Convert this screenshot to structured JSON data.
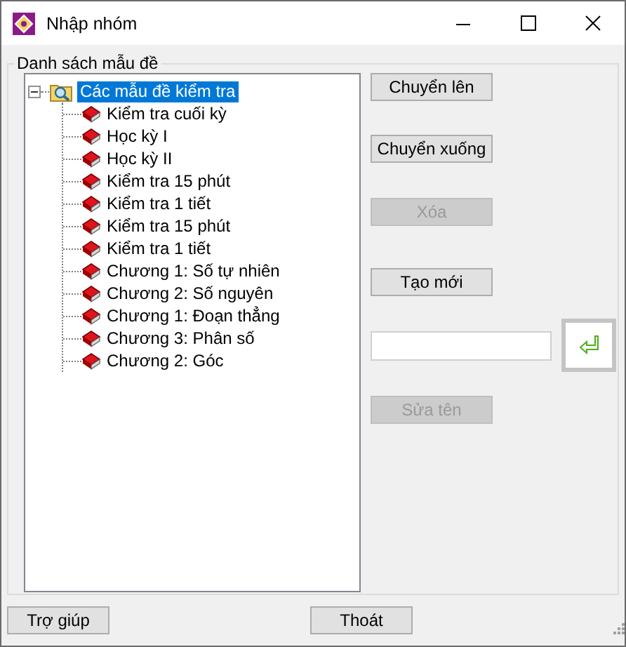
{
  "window": {
    "title": "Nhập nhóm"
  },
  "group": {
    "label": "Danh sách mẫu đề"
  },
  "tree": {
    "root": {
      "label": "Các mẫu đề kiểm tra",
      "selected": true,
      "expanded": true,
      "children": [
        {
          "label": "Kiểm tra cuối kỳ",
          "selected": false
        },
        {
          "label": "Học kỳ I",
          "selected": false
        },
        {
          "label": "Học kỳ II",
          "selected": false
        },
        {
          "label": "Kiểm tra 15 phút",
          "selected": false
        },
        {
          "label": "Kiểm tra 1 tiết",
          "selected": false
        },
        {
          "label": "Kiểm tra 15 phút",
          "selected": false
        },
        {
          "label": "Kiểm tra 1 tiết",
          "selected": false
        },
        {
          "label": "Chương 1: Số tự nhiên",
          "selected": false
        },
        {
          "label": "Chương 2: Số nguyên",
          "selected": false
        },
        {
          "label": "Chương 1: Đoạn thẳng",
          "selected": false
        },
        {
          "label": "Chương 3: Phân số",
          "selected": false
        },
        {
          "label": "Chương 2: Góc",
          "selected": false
        }
      ]
    }
  },
  "actions": [
    {
      "kind": "button",
      "label": "Chuyển lên",
      "disabled": false
    },
    {
      "kind": "button",
      "label": "Chuyển xuống",
      "disabled": false
    },
    {
      "kind": "button",
      "label": "Xóa",
      "disabled": true
    },
    {
      "kind": "button",
      "label": "Tạo mới",
      "disabled": false
    },
    {
      "kind": "field"
    },
    {
      "kind": "button",
      "label": "Sửa tên",
      "disabled": true
    }
  ],
  "footer_buttons": [
    {
      "label": "Trợ giúp"
    },
    {
      "label": "Thoát"
    }
  ]
}
